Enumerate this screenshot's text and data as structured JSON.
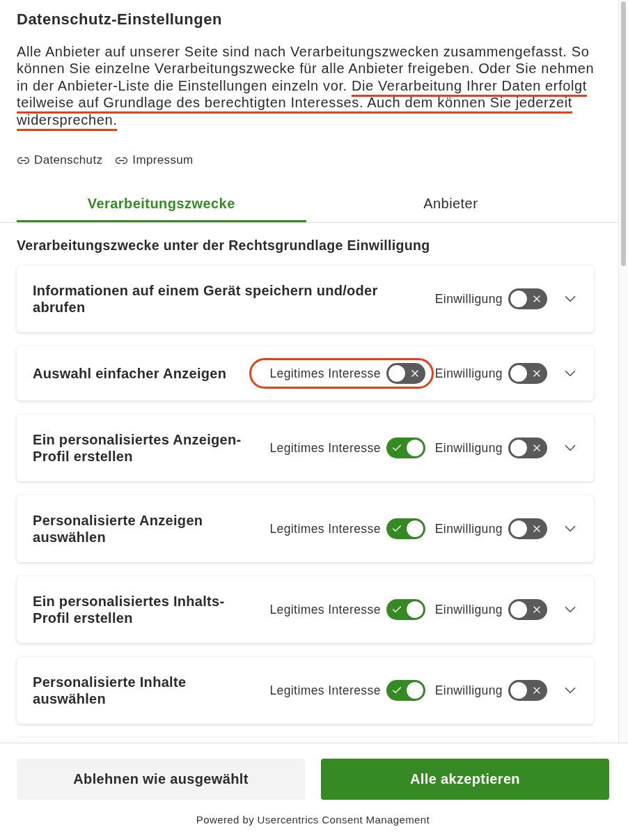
{
  "title": "Datenschutz-Einstellungen",
  "description": [
    {
      "text": "Alle Anbieter auf unserer Seite sind nach Verarbeitungszwecken zusammengefasst. So können Sie einzelne Verarbeitungszwecke für alle Anbieter freigeben. Oder Sie nehmen in der Anbieter-Liste die Einstellungen einzeln vor.",
      "underlined": false
    },
    {
      "text": "Die Verarbeitung Ihrer Daten erfolgt teilweise auf Grundlage des berechtigten Interesses. Auch dem können Sie jederzeit widersprechen.",
      "underlined": true
    }
  ],
  "links": [
    {
      "label": "Datenschutz"
    },
    {
      "label": "Impressum"
    }
  ],
  "tabs": [
    {
      "label": "Verarbeitungszwecke",
      "selected": true
    },
    {
      "label": "Anbieter",
      "selected": false
    }
  ],
  "section_heading": "Verarbeitungszwecke unter der Rechtsgrundlage Einwilligung",
  "purposes": [
    {
      "title": "Informationen auf einem Gerät speichern und/oder abrufen",
      "expanded": false,
      "toggles": [
        {
          "label": "Einwilligung",
          "on": false,
          "circled": false
        }
      ]
    },
    {
      "title": "Auswahl einfacher Anzeigen",
      "expanded": false,
      "toggles": [
        {
          "label": "Legitimes Interesse",
          "on": false,
          "circled": true
        },
        {
          "label": "Einwilligung",
          "on": false,
          "circled": false
        }
      ]
    },
    {
      "title": "Ein personalisiertes Anzeigen-Profil erstellen",
      "expanded": false,
      "toggles": [
        {
          "label": "Legitimes Interesse",
          "on": true,
          "circled": false
        },
        {
          "label": "Einwilligung",
          "on": false,
          "circled": false
        }
      ]
    },
    {
      "title": "Personalisierte Anzeigen auswählen",
      "expanded": false,
      "toggles": [
        {
          "label": "Legitimes Interesse",
          "on": true,
          "circled": false
        },
        {
          "label": "Einwilligung",
          "on": false,
          "circled": false
        }
      ]
    },
    {
      "title": "Ein personalisiertes Inhalts-Profil erstellen",
      "expanded": false,
      "toggles": [
        {
          "label": "Legitimes Interesse",
          "on": true,
          "circled": false
        },
        {
          "label": "Einwilligung",
          "on": false,
          "circled": false
        }
      ]
    },
    {
      "title": "Personalisierte Inhalte auswählen",
      "expanded": false,
      "toggles": [
        {
          "label": "Legitimes Interesse",
          "on": true,
          "circled": false
        },
        {
          "label": "Einwilligung",
          "on": false,
          "circled": false
        }
      ]
    }
  ],
  "buttons": [
    {
      "label": "Ablehnen wie ausgewählt",
      "kind": "secondary"
    },
    {
      "label": "Alle akzeptieren",
      "kind": "primary"
    }
  ],
  "footer_note": "Powered by Usercentrics Consent Management"
}
